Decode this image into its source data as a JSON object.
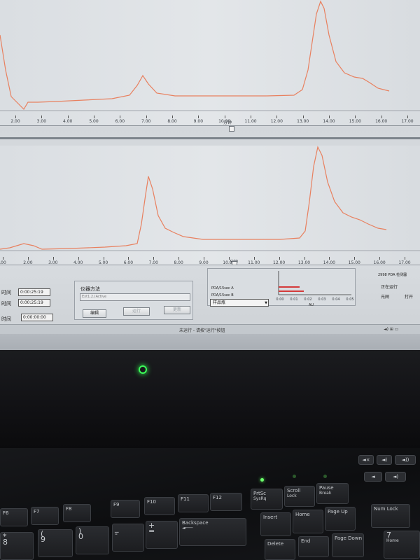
{
  "chromatogram_top": {
    "ticks": [
      "2.00",
      "3.00",
      "4.00",
      "5.00",
      "6.00",
      "7.00",
      "8.00",
      "9.00",
      "10.00",
      "11.00",
      "12.00",
      "13.00",
      "14.00",
      "15.00",
      "16.00",
      "17.00"
    ],
    "axis_title": "分钟"
  },
  "chromatogram_bottom": {
    "ticks": [
      ".00",
      "2.00",
      "3.00",
      "4.00",
      "5.00",
      "6.00",
      "7.00",
      "8.00",
      "9.00",
      "10.00",
      "11.00",
      "12.00",
      "13.00",
      "14.00",
      "15.00",
      "16.00",
      "17.00"
    ],
    "axis_title": "分钟"
  },
  "trace_color": "#e8805f",
  "controls": {
    "time_rows": [
      {
        "label": "时间",
        "value": "0:00:25:19"
      },
      {
        "label": "时间",
        "value": "0:00:25:19"
      },
      {
        "label": "时间",
        "value": "0:00:00:00"
      }
    ],
    "method_group_title": "仪器方法",
    "method_value": "Ext1.2.(Active",
    "edit_button": "编辑",
    "disabled_button_1": "运行",
    "disabled_button_2": "更新",
    "legend_a": "PDA/15sec A",
    "legend_b": "PDA/15sec B",
    "sample_dropdown": "样品瓶",
    "bar_ticks": [
      "0.00",
      "0.01",
      "0.02",
      "0.03",
      "0.04",
      "0.05"
    ],
    "bar_axis_label": "AU",
    "detector_title": "2998 PDA 检测器",
    "status_running": "正在运行",
    "option_1": "光闸",
    "option_2": "打开"
  },
  "statusbar": {
    "text": "未运行 - 请按\"运行\"按钮",
    "tray_icons": "◄) ⊞ ▭"
  },
  "keyboard": {
    "fkeys": [
      "F6",
      "F7",
      "F8",
      "F9",
      "F10",
      "F11",
      "F12"
    ],
    "lock_keys": [
      {
        "top": "PrtSc",
        "bottom": "SysRq"
      },
      {
        "top": "Scroll",
        "bottom": "Lock"
      },
      {
        "top": "Pause",
        "bottom": "Break"
      }
    ],
    "numrow": [
      {
        "top": "*",
        "bottom": "8"
      },
      {
        "top": "(",
        "bottom": "9"
      },
      {
        "top": ")",
        "bottom": "0"
      },
      {
        "top": "_",
        "bottom": "-"
      },
      {
        "top": "+",
        "bottom": "="
      }
    ],
    "backspace": "Backspace",
    "nav_top": [
      "Insert",
      "Home",
      "Page Up"
    ],
    "nav_bottom": [
      "Delete",
      "End",
      "Page Down"
    ],
    "numlock": "Num Lock",
    "num7_top": "7",
    "num7_bottom": "Home"
  }
}
